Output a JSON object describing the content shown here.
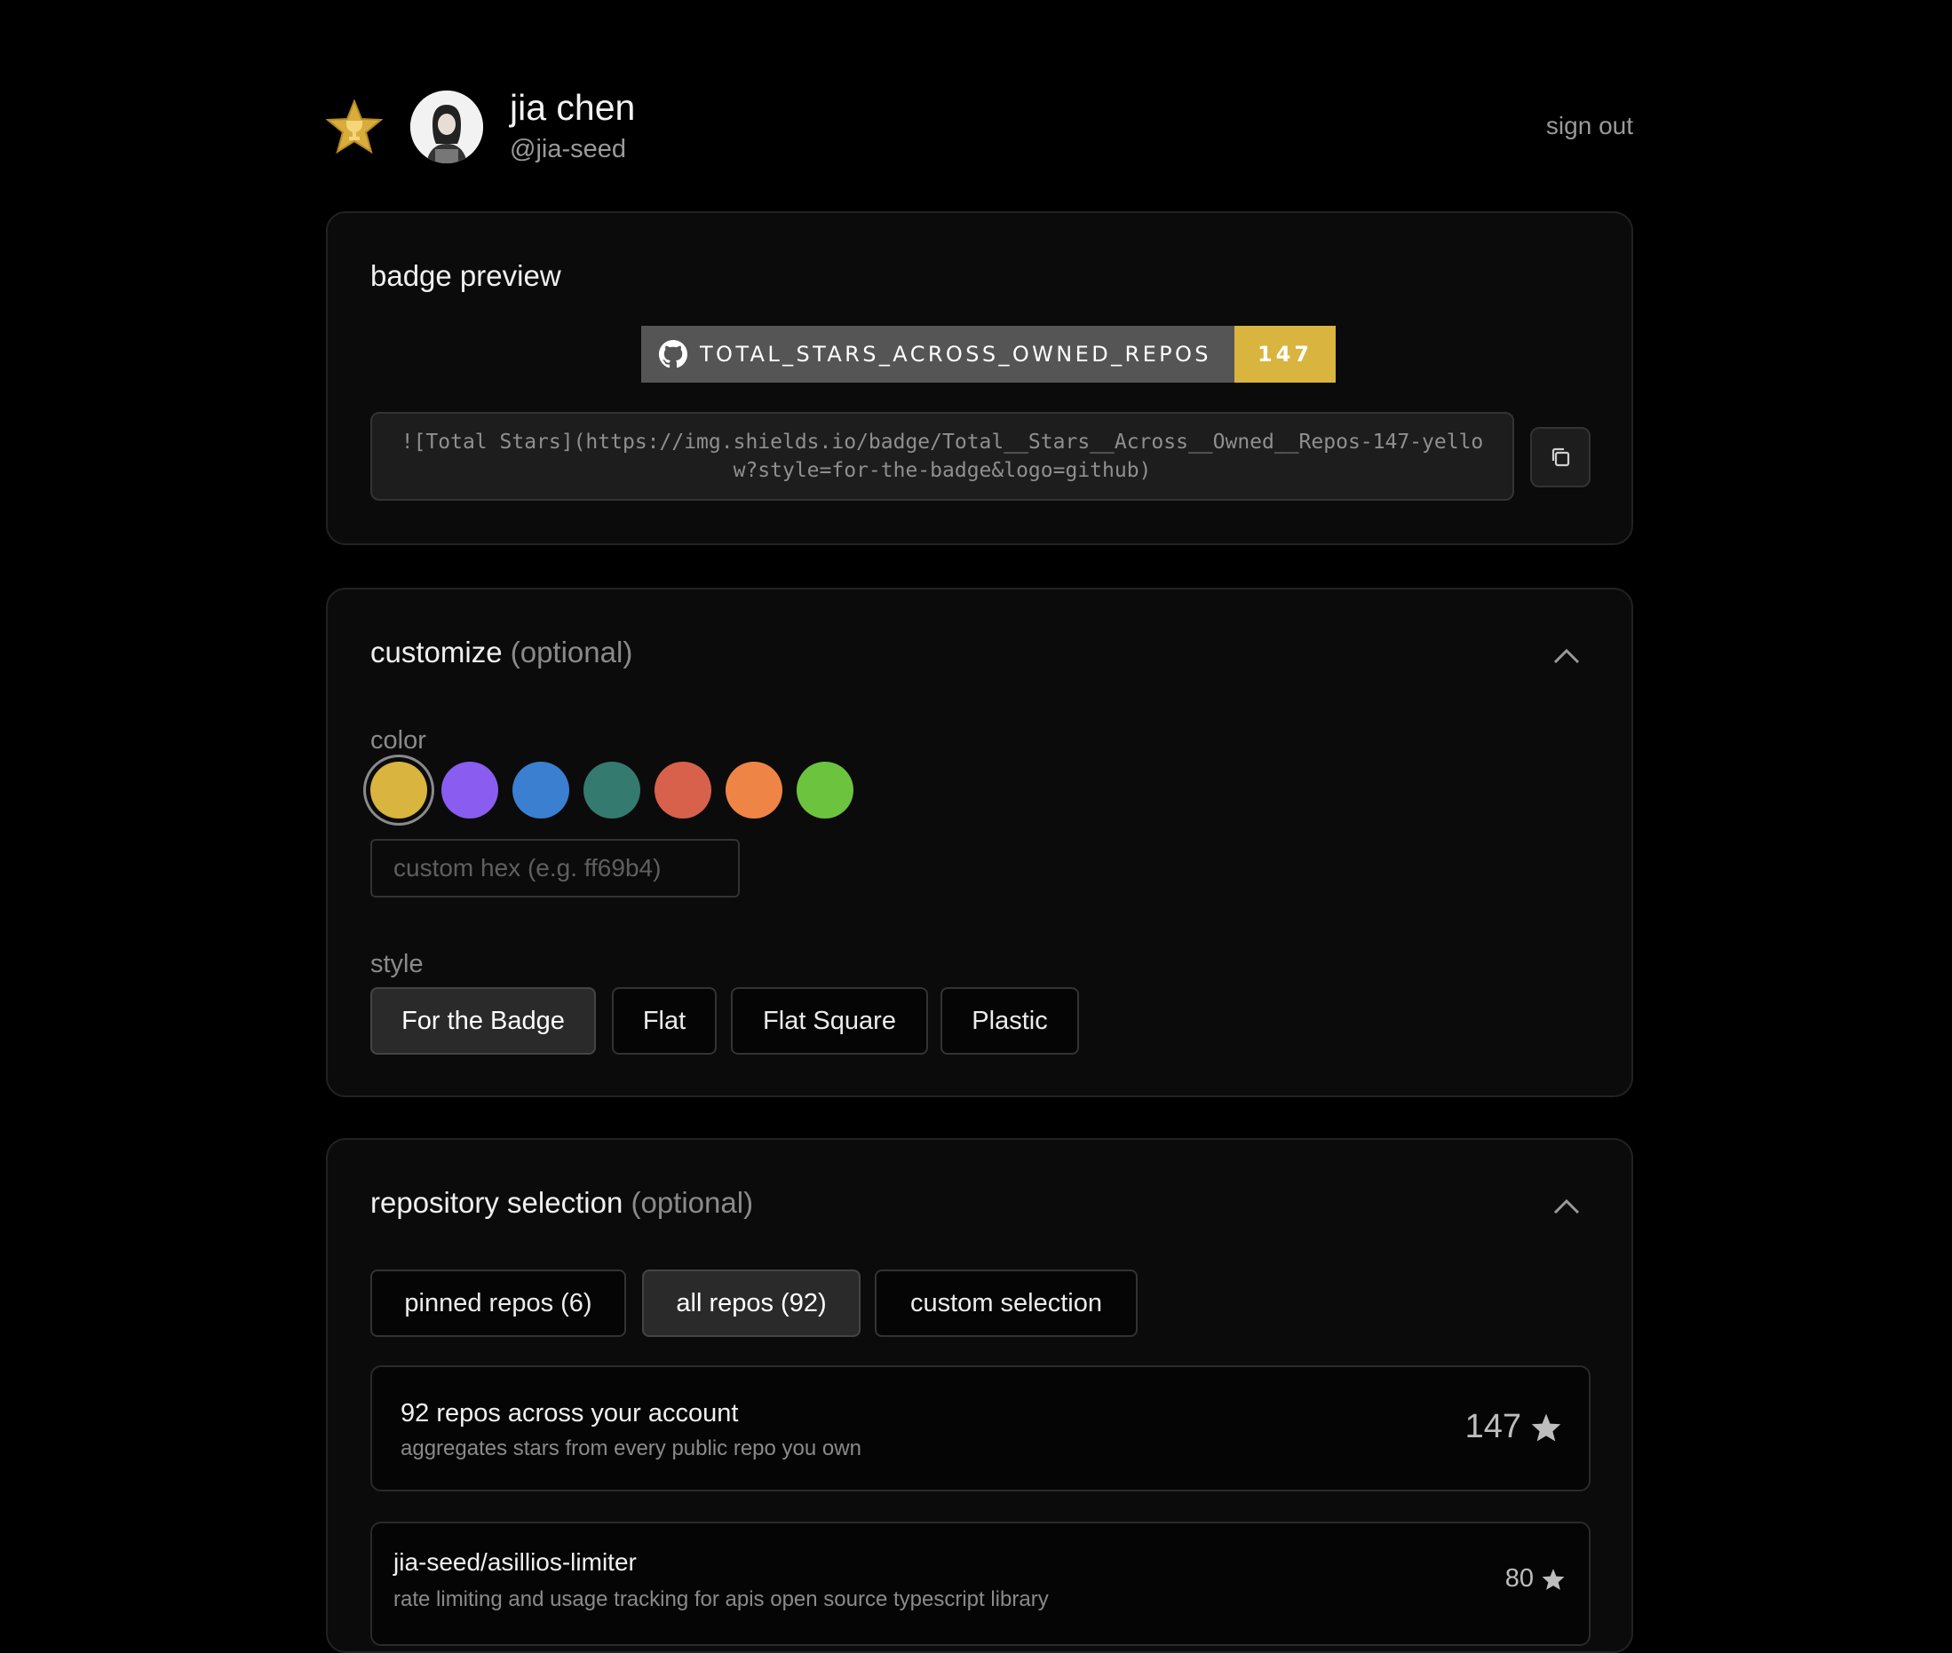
{
  "user": {
    "name": "jia chen",
    "handle": "@jia-seed",
    "signout_label": "sign out"
  },
  "preview": {
    "title": "badge preview",
    "badge_label": "TOTAL_STARS_ACROSS_OWNED_REPOS",
    "badge_value": "147",
    "badge_color": "#d9b43e",
    "markdown": "![Total Stars](https://img.shields.io/badge/Total__Stars__Across__Owned__Repos-147-yellow?style=for-the-badge&logo=github)",
    "copy_icon": "copy-icon"
  },
  "customize": {
    "title": "customize",
    "optional": "(optional)",
    "color_label": "color",
    "colors": [
      "#d9b43e",
      "#8a5cf0",
      "#3a7fd0",
      "#357a6e",
      "#d8614c",
      "#ef8447",
      "#6cc43e"
    ],
    "selected_color": "#d9b43e",
    "hex_placeholder": "custom hex (e.g. ff69b4)",
    "style_label": "style",
    "styles": [
      "For the Badge",
      "Flat",
      "Flat Square",
      "Plastic"
    ],
    "selected_style": "For the Badge"
  },
  "repos": {
    "title": "repository selection",
    "optional": "(optional)",
    "tabs": [
      "pinned repos (6)",
      "all repos (92)",
      "custom selection"
    ],
    "selected_tab": "all repos (92)",
    "summary": {
      "title": "92 repos across your account",
      "subtitle": "aggregates stars from every public repo you own",
      "stars": "147"
    },
    "items": [
      {
        "name": "jia-seed/asillios-limiter",
        "description": "rate limiting and usage tracking for apis open source typescript library",
        "stars": "80"
      }
    ]
  }
}
